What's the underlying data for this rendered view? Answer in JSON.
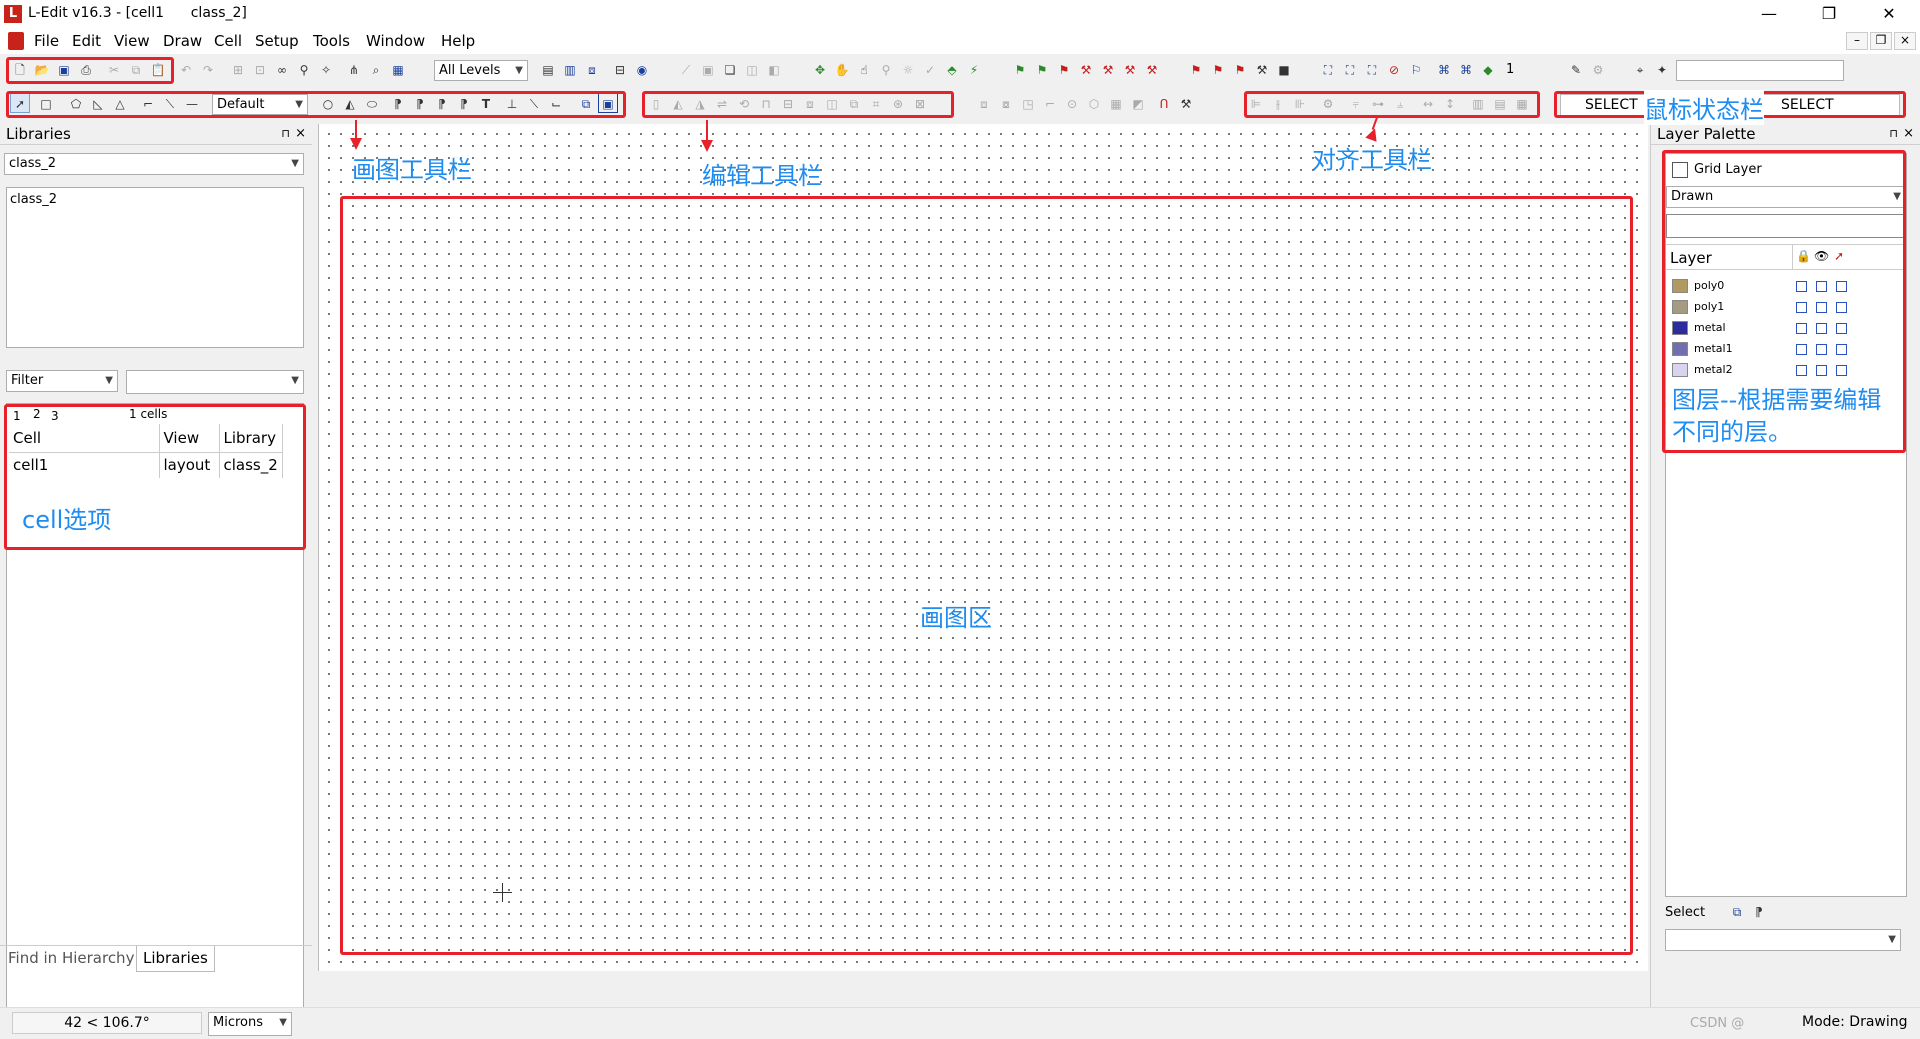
{
  "window": {
    "title": "L-Edit v16.3 - [cell1      class_2]",
    "logo_letter": "L",
    "minimize": "—",
    "maximize": "❐",
    "close": "✕"
  },
  "menu": {
    "items": [
      "File",
      "Edit",
      "View",
      "Draw",
      "Cell",
      "Setup",
      "Tools",
      "Window",
      "Help"
    ],
    "mdi_minimize": "–",
    "mdi_restore": "❐",
    "mdi_close": "×"
  },
  "toolbar1": {
    "levels_combo": "All Levels",
    "level_number": "1"
  },
  "toolbar2": {
    "style_combo": "Default",
    "mouse_left": "SELECT",
    "mouse_right": "SELECT"
  },
  "annotations": {
    "draw_toolbar": "画图工具栏",
    "edit_toolbar": "编辑工具栏",
    "align_toolbar": "对齐工具栏",
    "mouse_status": "鼠标状态栏",
    "cell_options": "cell选项",
    "drawing_area": "画图区",
    "layers_note": "图层--根据需要编辑不同的层。"
  },
  "libraries": {
    "header": "Libraries",
    "pin": "⊓",
    "close": "×",
    "selected_library": "class_2",
    "list": [
      "class_2"
    ],
    "filter_label": "Filter",
    "page_tabs": [
      "1",
      "2",
      "3"
    ],
    "cell_count": "1 cells",
    "columns": [
      "Cell",
      "View",
      "Library"
    ],
    "rows": [
      {
        "cell": "cell1",
        "view": "layout",
        "library": "class_2"
      }
    ],
    "bottom_tabs": [
      "Find in Hierarchy",
      "Libraries"
    ]
  },
  "layer_palette": {
    "header": "Layer Palette",
    "grid_layer": "Grid Layer",
    "mode_combo": "Drawn",
    "column_layer": "Layer",
    "layers": [
      {
        "name": "poly0",
        "color": "#b09a60"
      },
      {
        "name": "poly1",
        "color": "#a59a82"
      },
      {
        "name": "metal",
        "color": "#2c2c9c"
      },
      {
        "name": "metal1",
        "color": "#7070b0"
      },
      {
        "name": "metal2",
        "color": "#d8d4f0"
      }
    ],
    "select_label": "Select"
  },
  "status": {
    "coords": "42 < 106.7°",
    "units": "Microns",
    "mode": "Mode: Drawing",
    "watermark": "CSDN @"
  },
  "colors": {
    "annotation_red": "#e8202a",
    "annotation_blue": "#1e8cf0",
    "brand_red": "#c8231a"
  }
}
